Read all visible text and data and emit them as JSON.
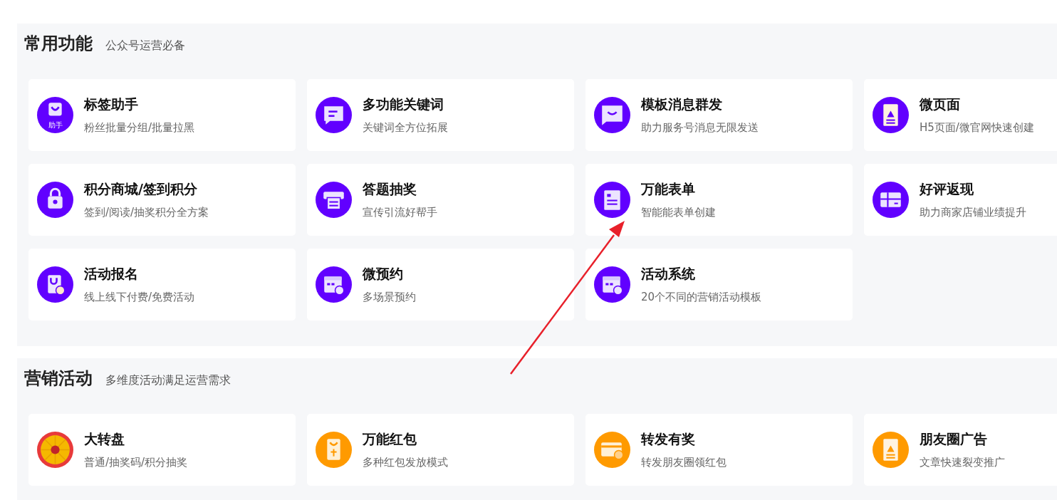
{
  "sections": [
    {
      "title": "常用功能",
      "subtitle": "公众号运营必备",
      "items": [
        {
          "name": "标签助手",
          "desc": "粉丝批量分组/批量拉黑",
          "color": "#6100ff",
          "badge": "助手"
        },
        {
          "name": "多功能关键词",
          "desc": "关键词全方位拓展",
          "color": "#6100ff"
        },
        {
          "name": "模板消息群发",
          "desc": "助力服务号消息无限发送",
          "color": "#6100ff"
        },
        {
          "name": "微页面",
          "desc": "H5页面/微官网快速创建",
          "color": "#6100ff"
        },
        {
          "name": "积分商城/签到积分",
          "desc": "签到/阅读/抽奖积分全方案",
          "color": "#6100ff"
        },
        {
          "name": "答题抽奖",
          "desc": "宣传引流好帮手",
          "color": "#6100ff"
        },
        {
          "name": "万能表单",
          "desc": "智能能表单创建",
          "color": "#6100ff"
        },
        {
          "name": "好评返现",
          "desc": "助力商家店铺业绩提升",
          "color": "#6100ff"
        },
        {
          "name": "活动报名",
          "desc": "线上线下付费/免费活动",
          "color": "#6100ff"
        },
        {
          "name": "微预约",
          "desc": "多场景预约",
          "color": "#6100ff"
        },
        {
          "name": "活动系统",
          "desc": "20个不同的营销活动模板",
          "color": "#6100ff"
        }
      ]
    },
    {
      "title": "营销活动",
      "subtitle": "多维度活动满足运营需求",
      "items": [
        {
          "name": "大转盘",
          "desc": "普通/抽奖码/积分抽奖",
          "color": "#e83a3a"
        },
        {
          "name": "万能红包",
          "desc": "多种红包发放模式",
          "color": "#ff9a00"
        },
        {
          "name": "转发有奖",
          "desc": "转发朋友圈领红包",
          "color": "#ff9a00"
        },
        {
          "name": "朋友圈广告",
          "desc": "文章快速裂变推广",
          "color": "#ff9a00"
        }
      ]
    }
  ]
}
